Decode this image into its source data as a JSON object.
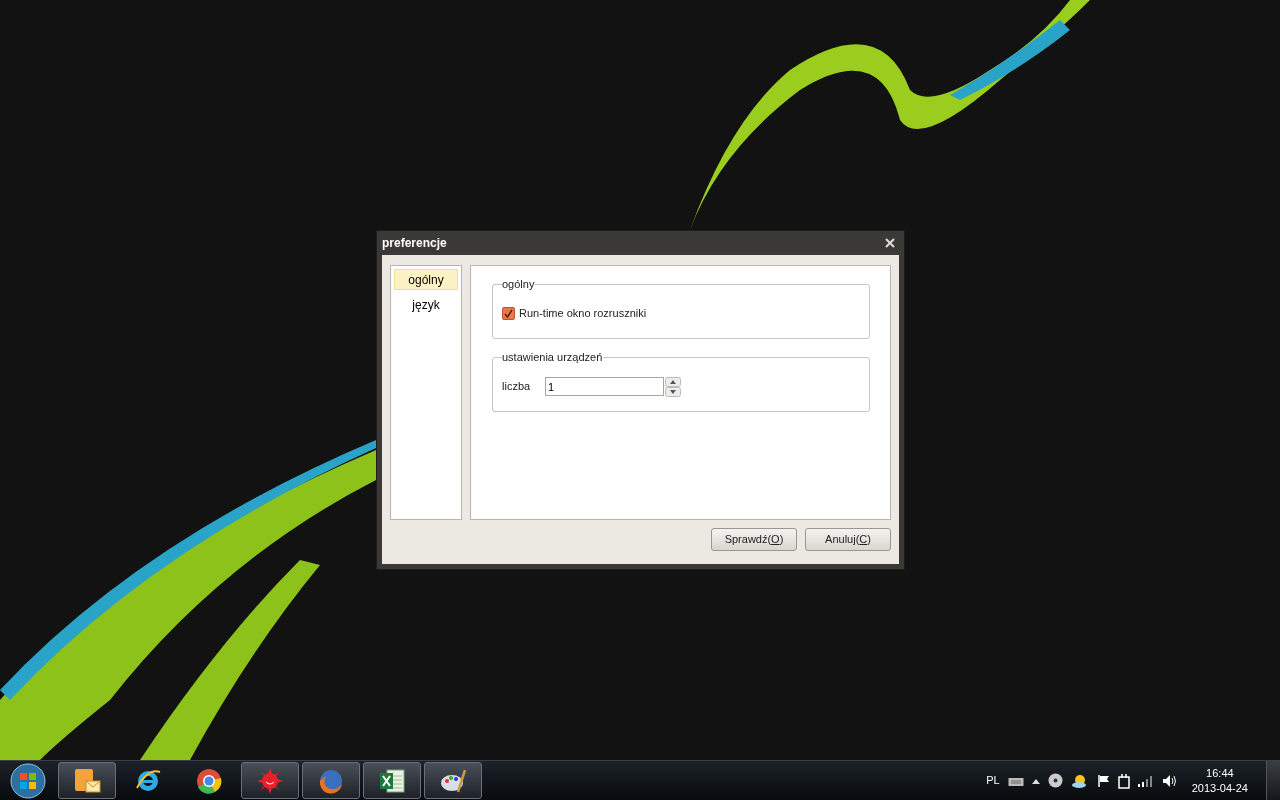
{
  "window": {
    "title": "preferencje"
  },
  "sidebar": {
    "items": [
      {
        "label": "ogólny",
        "selected": true
      },
      {
        "label": "język",
        "selected": false
      }
    ]
  },
  "groups": [
    {
      "title": "ogólny",
      "kind": "checkbox",
      "label": "Run-time okno rozruszniki",
      "checked": true
    },
    {
      "title": "ustawienia urządzeń",
      "kind": "spinbox",
      "label": "liczba",
      "value": "1"
    }
  ],
  "buttons": [
    {
      "label_parts": [
        "Sprawdź(",
        "O",
        ")"
      ]
    },
    {
      "label_parts": [
        "Anuluj(",
        "C",
        ")"
      ]
    }
  ],
  "taskbar": {
    "apps": [
      {
        "kind": "mail",
        "running": true
      },
      {
        "kind": "browser-e",
        "running": false
      },
      {
        "kind": "browser-round",
        "running": false
      },
      {
        "kind": "sun",
        "running": true
      },
      {
        "kind": "fox",
        "running": true
      },
      {
        "kind": "sheet",
        "running": true
      },
      {
        "kind": "palette",
        "running": true
      }
    ],
    "language": "PL",
    "time": "16:44",
    "date": "2013-04-24"
  }
}
